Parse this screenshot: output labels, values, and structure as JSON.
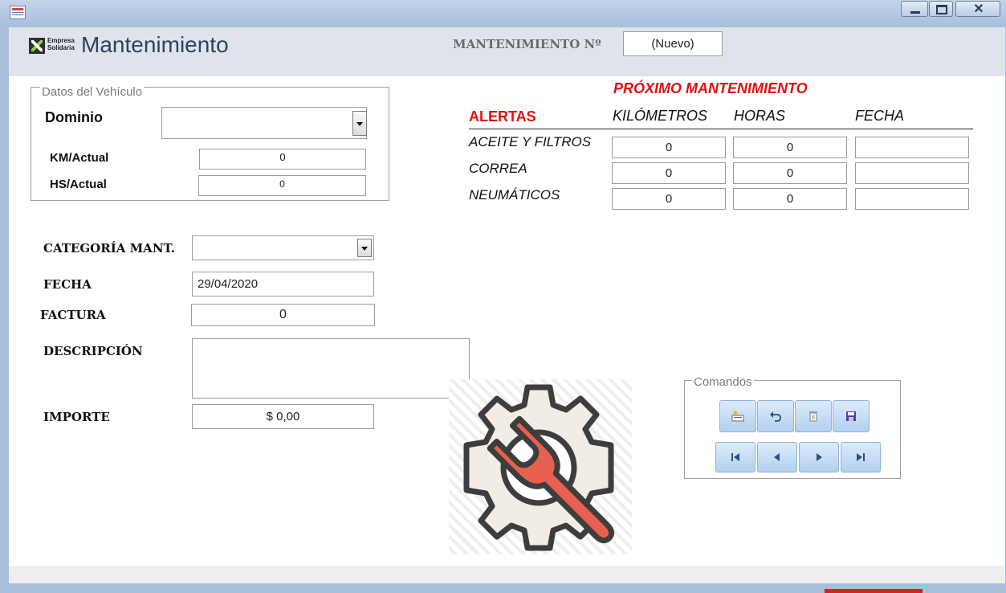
{
  "window": {
    "close_glyph": "✕"
  },
  "form": {
    "title": "Mantenimiento",
    "logo_text_line1": "Empresa",
    "logo_text_line2": "Solidaria",
    "record_label": "MANTENIMIENTO Nº",
    "record_value": "(Nuevo)"
  },
  "vehicle": {
    "legend": "Datos del Vehículo",
    "dominio_label": "Dominio",
    "dominio_value": "",
    "km_label": "KM/Actual",
    "km_value": "0",
    "hs_label": "HS/Actual",
    "hs_value": "0"
  },
  "alerts": {
    "title": "PRÓXIMO MANTENIMIENTO",
    "label": "ALERTAS",
    "columns": [
      "KILÓMETROS",
      "HORAS",
      "FECHA"
    ],
    "rows": [
      {
        "label": "ACEITE Y FILTROS",
        "km": "0",
        "horas": "0",
        "fecha": ""
      },
      {
        "label": "CORREA",
        "km": "0",
        "horas": "0",
        "fecha": ""
      },
      {
        "label": "NEUMÁTICOS",
        "km": "0",
        "horas": "0",
        "fecha": ""
      }
    ]
  },
  "maintenance": {
    "categoria_label": "CATEGORÍA MANT.",
    "categoria_value": "",
    "fecha_label": "FECHA",
    "fecha_value": "29/04/2020",
    "factura_label": "FACTURA",
    "factura_value": "0",
    "descripcion_label": "DESCRIPCIÓN",
    "descripcion_value": "",
    "importe_label": "IMPORTE",
    "importe_value": "$ 0,00"
  },
  "commands": {
    "legend": "Comandos",
    "icons": [
      "new-record-icon",
      "undo-icon",
      "delete-icon",
      "save-icon",
      "first-record-icon",
      "previous-record-icon",
      "next-record-icon",
      "last-record-icon"
    ]
  },
  "colors": {
    "accent_red": "#e01010",
    "title_blue": "#2f4260",
    "button_blue": "#b3d0ef",
    "gear_fill": "#f1ece4",
    "wrench_fill": "#e8604f"
  }
}
